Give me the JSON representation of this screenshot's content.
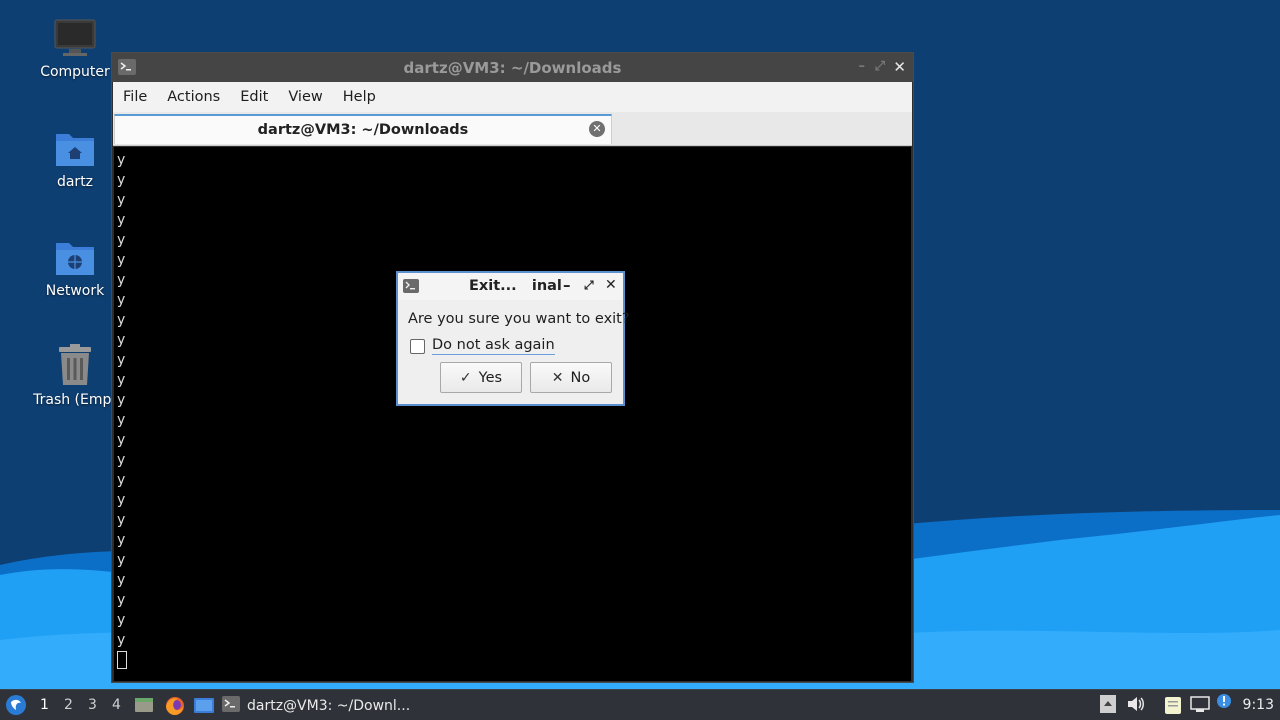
{
  "desktop": {
    "icons": [
      {
        "label": "Computer",
        "icon": "computer-icon"
      },
      {
        "label": "dartz",
        "icon": "home-folder-icon"
      },
      {
        "label": "Network",
        "icon": "network-folder-icon"
      },
      {
        "label": "Trash (Empt",
        "icon": "trash-icon"
      }
    ]
  },
  "terminal": {
    "title": "dartz@VM3: ~/Downloads",
    "menu": [
      "File",
      "Actions",
      "Edit",
      "View",
      "Help"
    ],
    "tab_title": "dartz@VM3: ~/Downloads",
    "output_line": "y"
  },
  "dialog": {
    "title": "Exit...",
    "title_suffix": "inal",
    "message": "Are you sure you want to exit?",
    "checkbox_label": "Do not ask again",
    "checkbox_checked": false,
    "yes_label": "Yes",
    "no_label": "No"
  },
  "taskbar": {
    "workspaces": [
      "1",
      "2",
      "3",
      "4"
    ],
    "active_workspace": "1",
    "task_label": "dartz@VM3: ~/Downl...",
    "clock": "9:13"
  },
  "colors": {
    "desktop_bg": "#0e3f72",
    "wave_light": "#1fa0f5",
    "dialog_border": "#5b8fd0",
    "terminal_bg": "#000000"
  }
}
